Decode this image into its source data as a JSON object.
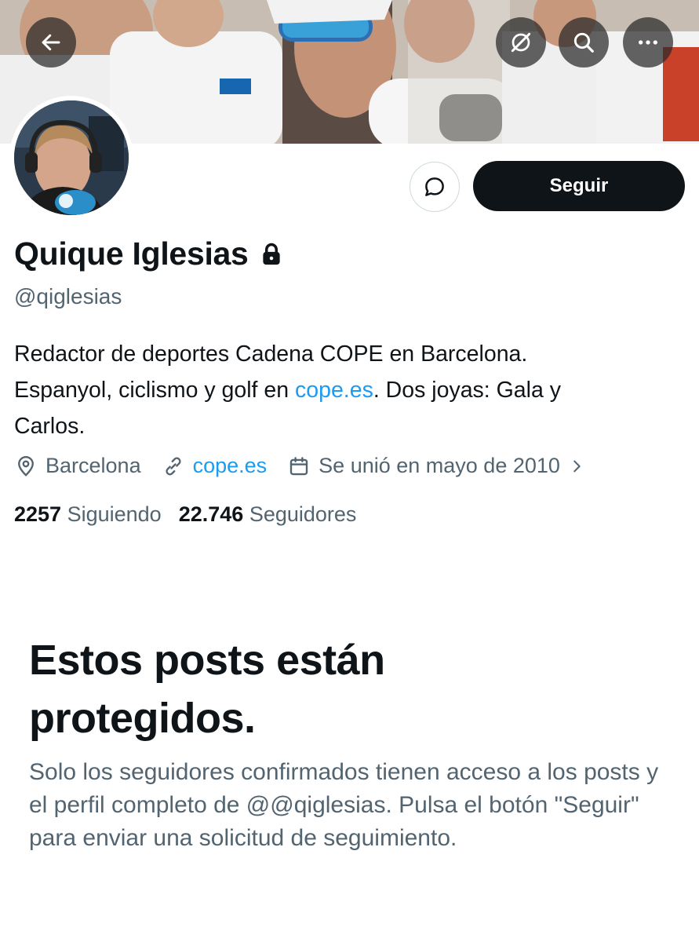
{
  "header": {
    "back_icon": "arrow-left-icon",
    "grok_icon": "grok-icon",
    "search_icon": "search-icon",
    "more_icon": "more-horizontal-icon"
  },
  "profile": {
    "display_name": "Quique Iglesias",
    "handle": "@qiglesias",
    "bio_line1": "Redactor de deportes Cadena COPE en Barcelona.",
    "bio_line2_pre": "Espanyol, ciclismo y golf en ",
    "bio_link": "cope.es",
    "bio_line2_post": ". Dos joyas: Gala y",
    "bio_line3": "Carlos.",
    "location": "Barcelona",
    "website": "cope.es",
    "joined": "Se unió en mayo de 2010",
    "following_count": "2257",
    "following_label": "Siguiendo",
    "followers_count": "22.746",
    "followers_label": "Seguidores"
  },
  "actions": {
    "follow_label": "Seguir",
    "message_icon": "message-icon"
  },
  "protected": {
    "title_line1": "Estos posts están",
    "title_line2": "protegidos.",
    "text": "Solo los seguidores confirmados tienen acceso a los posts y el perfil completo de @@qiglesias. Pulsa el botón \"Seguir\" para enviar una solicitud de seguimiento."
  },
  "colors": {
    "accent_link": "#1d9bf0",
    "text_primary": "#0f1419",
    "text_secondary": "#536471",
    "button_dark": "#0f1419"
  }
}
